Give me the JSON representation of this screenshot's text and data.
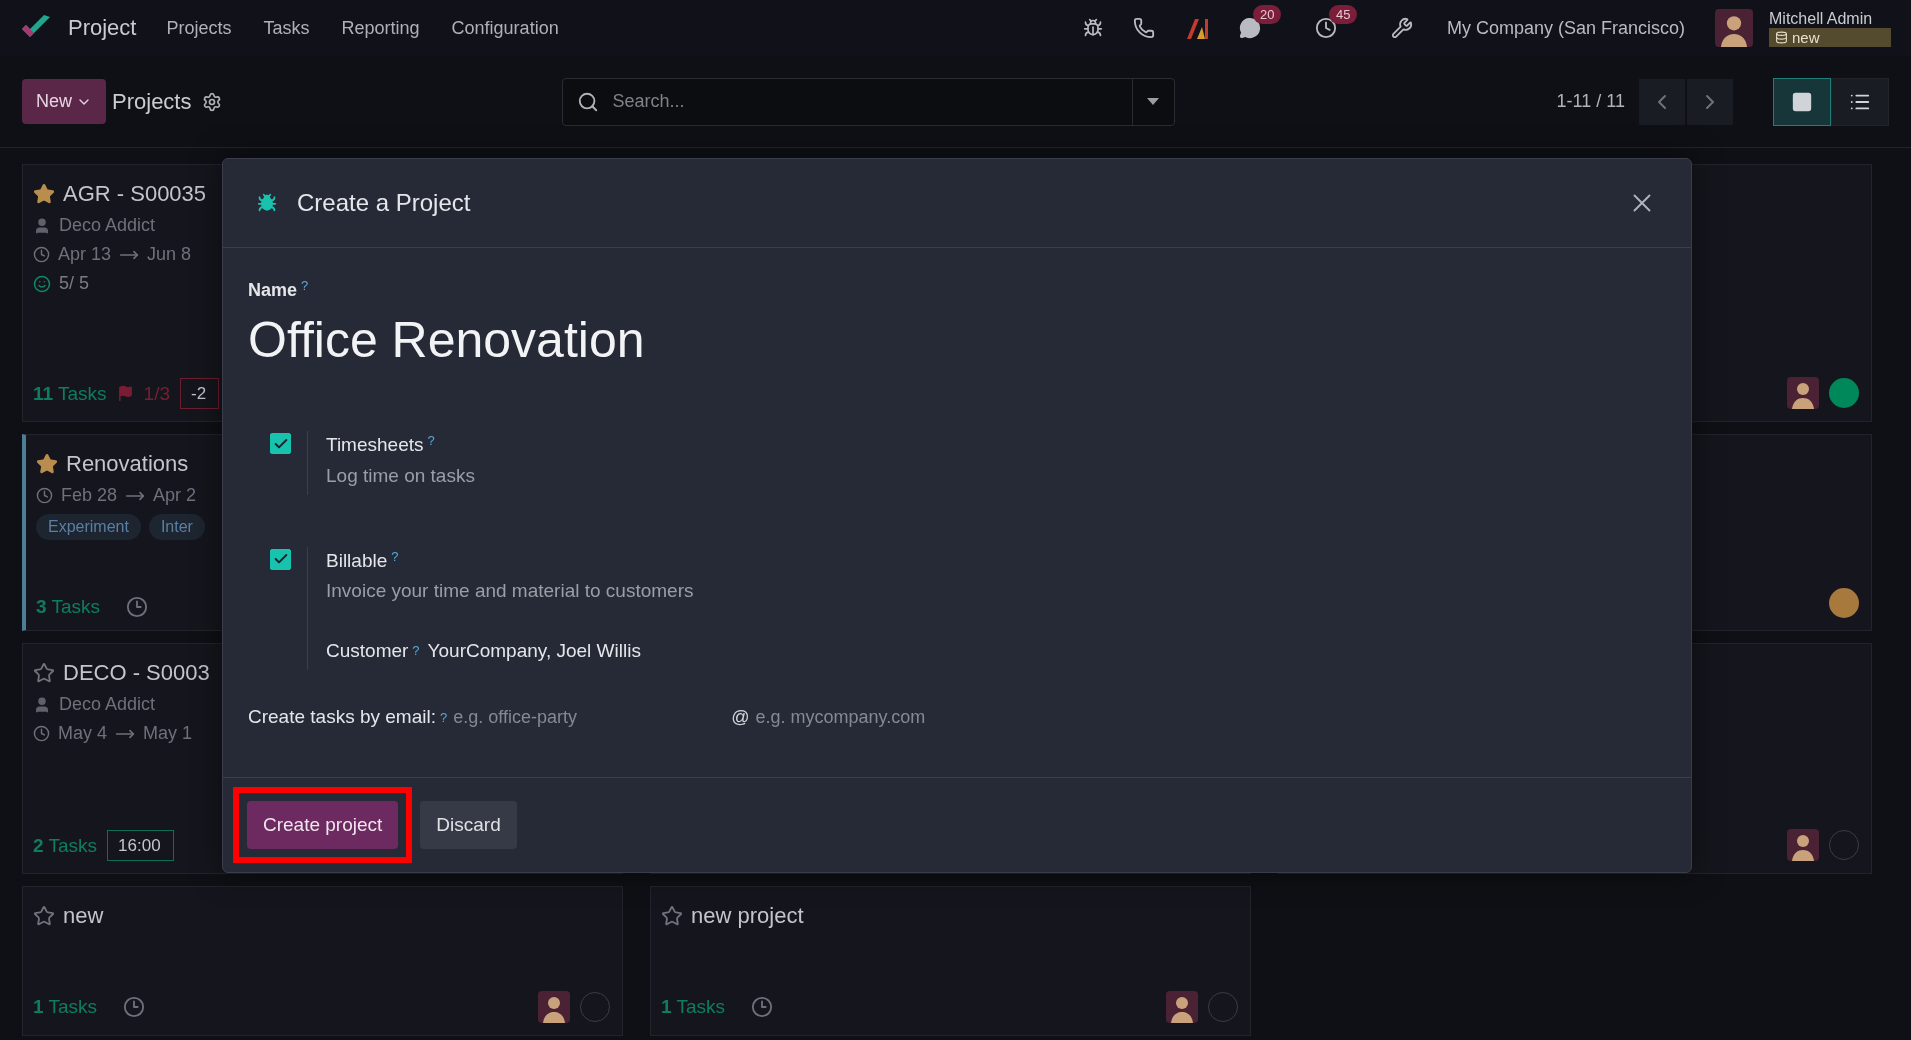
{
  "navbar": {
    "app_name": "Project",
    "menu": [
      "Projects",
      "Tasks",
      "Reporting",
      "Configuration"
    ],
    "chat_count": "20",
    "activity_count": "45",
    "company": "My Company (San Francisco)",
    "user_name": "Mitchell Admin",
    "database": "new"
  },
  "control_panel": {
    "new_button": "New",
    "breadcrumb": "Projects",
    "search_placeholder": "Search...",
    "pager": "1-11 / 11",
    "views": [
      {
        "kind": "kanban",
        "selected": true
      },
      {
        "kind": "list",
        "selected": false
      }
    ]
  },
  "cards": [
    {
      "kind": "project",
      "title": "AGR - S00035",
      "starred": true,
      "customer": "Deco Addict",
      "date_start": "Apr 13",
      "date_end": "Jun 8",
      "rating": "5/ 5",
      "tasks_count": "11",
      "tasks_label": "Tasks",
      "milestone": "1/3",
      "deadline": "-2"
    },
    {
      "kind": "hidden"
    },
    {
      "kind": "project",
      "avatar": true,
      "status": {
        "color": "#00875a"
      }
    },
    {
      "kind": "project",
      "title": "Renovations",
      "starred": true,
      "color": "#4e7d96",
      "date_start": "Feb 28",
      "date_end": "Apr 2",
      "tags": [
        "Experiment",
        "Inter"
      ],
      "tasks_count": "3",
      "tasks_label": "Tasks",
      "clock": true
    },
    {
      "kind": "hidden"
    },
    {
      "kind": "project",
      "status": {
        "color": "#a7793d"
      }
    },
    {
      "kind": "project",
      "title": "DECO - S0003",
      "starred": false,
      "customer": "Deco Addict",
      "date_start": "May 4",
      "date_end": "May 1",
      "tasks_count": "2",
      "tasks_label": "Tasks",
      "time": "16:00"
    },
    {
      "kind": "covered"
    },
    {
      "kind": "project",
      "avatar": true
    },
    {
      "kind": "project",
      "title": "new",
      "starred": false,
      "tasks_count": "1",
      "tasks_label": "Tasks",
      "clock": true,
      "avatar": true
    },
    {
      "kind": "project",
      "title": "new project",
      "starred": false,
      "tasks_count": "1",
      "tasks_label": "Tasks",
      "clock": true,
      "avatar": true
    }
  ],
  "dialog": {
    "title": "Create a Project",
    "name_label": "Name",
    "name_help": "?",
    "name_value": "Office Renovation",
    "options": [
      {
        "label": "Timesheets",
        "help": "?",
        "description": "Log time on tasks",
        "checked": true
      },
      {
        "label": "Billable",
        "help": "?",
        "description": "Invoice your time and material to customers",
        "checked": true,
        "customer_label": "Customer",
        "customer_help": "?",
        "customer_value": "YourCompany, Joel Willis"
      }
    ],
    "email_label": "Create tasks by email:",
    "email_help": "?",
    "alias_placeholder": "e.g. office-party",
    "at": "@",
    "domain_placeholder": "e.g. mycompany.com",
    "buttons": [
      {
        "label": "Create project",
        "kind": "primary",
        "highlighted": true
      },
      {
        "label": "Discard",
        "kind": "secondary",
        "highlighted": false
      }
    ]
  }
}
